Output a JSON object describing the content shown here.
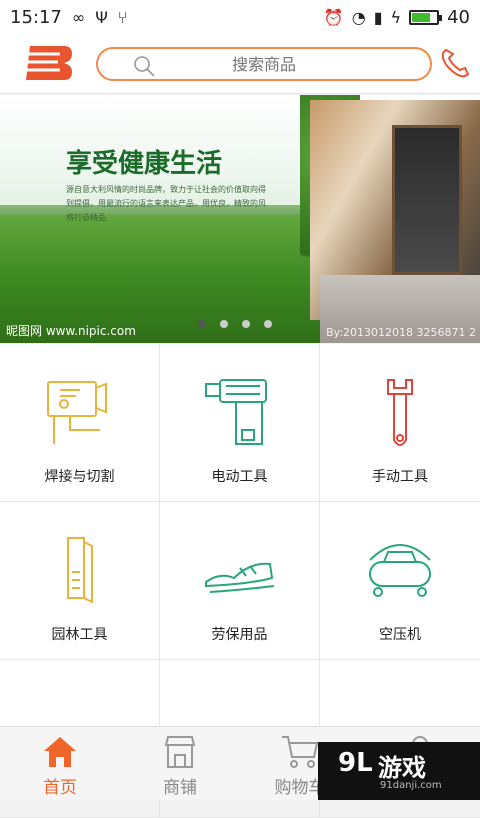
{
  "status_bar": {
    "time": "15:17",
    "battery_level": "40",
    "battery_fill_fraction": 0.75
  },
  "header": {
    "search_placeholder": "搜索商品"
  },
  "banner": {
    "headline": "享受健康生活",
    "subline": "源自意大利风情的时尚品牌，致力于让社会的价值取向得到提倡，用最流行的语言来表达产品，用优良，精致的风格打造精品",
    "watermark_left": "昵图网 www.nipic.com",
    "watermark_right": "By:2013012018 3256871 2",
    "dot_count": 4,
    "active_dot": 0
  },
  "categories": [
    {
      "label": "焊接与切割",
      "icon": "welding-machine-icon",
      "color": "#e9b43a"
    },
    {
      "label": "电动工具",
      "icon": "power-drill-icon",
      "color": "#2aa57a"
    },
    {
      "label": "手动工具",
      "icon": "wrench-icon",
      "color": "#e0453a"
    },
    {
      "label": "园林工具",
      "icon": "garden-tool-icon",
      "color": "#e9b43a"
    },
    {
      "label": "劳保用品",
      "icon": "shoes-icon",
      "color": "#2aa57a"
    },
    {
      "label": "空压机",
      "icon": "air-compressor-icon",
      "color": "#2aa57a"
    }
  ],
  "tabs": [
    {
      "label": "首页",
      "icon": "home-icon",
      "active": true
    },
    {
      "label": "商铺",
      "icon": "shop-icon",
      "active": false
    },
    {
      "label": "购物车",
      "icon": "cart-icon",
      "active": false
    },
    {
      "label": "",
      "icon": "user-icon",
      "active": false
    }
  ],
  "ad_overlay": {
    "brand": "游戏",
    "site": "91danji.com",
    "mark": "9L"
  },
  "colors": {
    "accent": "#f08a4b",
    "active_tab": "#f0662a"
  }
}
